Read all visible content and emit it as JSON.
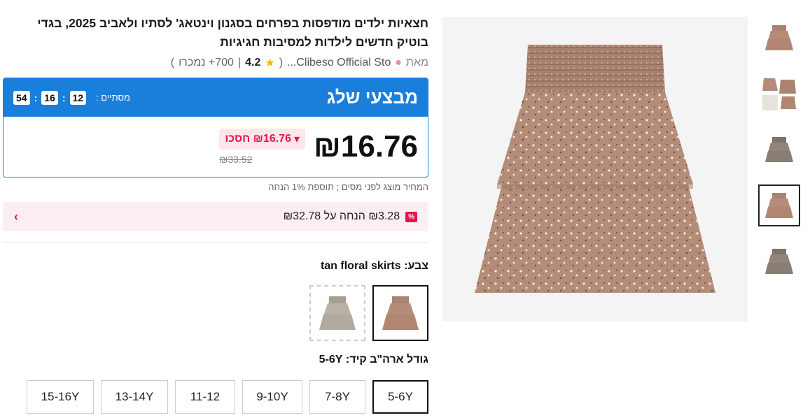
{
  "product": {
    "title": "חצאיות ילדים מודפסות בפרחים בסגנון וינטאג' לסתיו ולאביב 2025, בגדי בוטיק חדשים לילדות למסיבות חגיגיות",
    "by_label": "מאת",
    "store_name": "Clibeso Official Sto...",
    "rating": "4.2",
    "sold": "700+ נמכרו"
  },
  "deal": {
    "title": "מבצעי שלג",
    "ends_label": "מסתיים :",
    "timer": {
      "h": "12",
      "m": "16",
      "s": "54"
    },
    "price": "₪16.76",
    "save_text": "₪16.76 חסכו",
    "old_price": "₪33.52"
  },
  "tax_note": "המחיר מוצג לפני מסים ; תוספת 1% הנחה",
  "promo": {
    "tag": "%",
    "text": "₪3.28 הנחה על ₪32.78"
  },
  "color": {
    "label": "צבע:",
    "value": "tan floral skirts"
  },
  "size": {
    "label": "גודל ארה\"ב קיד:",
    "value": "5-6Y",
    "options": [
      "5-6Y",
      "7-8Y",
      "9-10Y",
      "11-12",
      "13-14Y",
      "15-16Y"
    ]
  },
  "colors": {
    "accent": "#1a7fdb",
    "sale": "#e0184b",
    "skirt_tan": "#b48c78",
    "skirt_grey": "#8f8579"
  }
}
